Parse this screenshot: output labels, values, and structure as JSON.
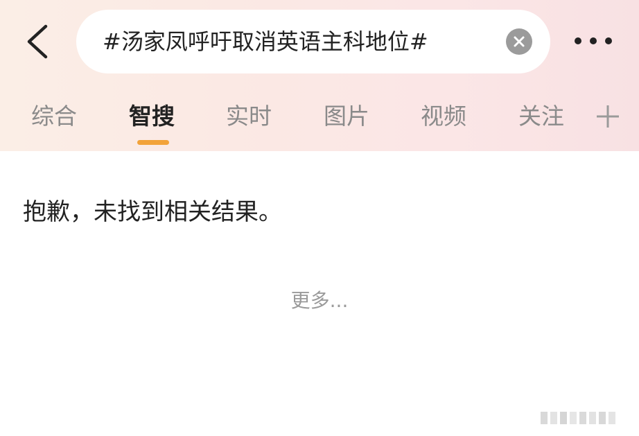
{
  "search": {
    "query": "#汤家凤呼吁取消英语主科地位#"
  },
  "tabs": [
    {
      "label": "综合"
    },
    {
      "label": "智搜"
    },
    {
      "label": "实时"
    },
    {
      "label": "图片"
    },
    {
      "label": "视频"
    },
    {
      "label": "关注"
    }
  ],
  "active_tab": "智搜",
  "results": {
    "empty_message": "抱歉，未找到相关结果。",
    "more_label": "更多..."
  },
  "colors": {
    "accent": "#f2a33a",
    "header_bg": "#fbe9e4"
  },
  "icons": [
    "back-arrow-icon",
    "clear-icon",
    "more-dots-icon",
    "plus-icon"
  ]
}
